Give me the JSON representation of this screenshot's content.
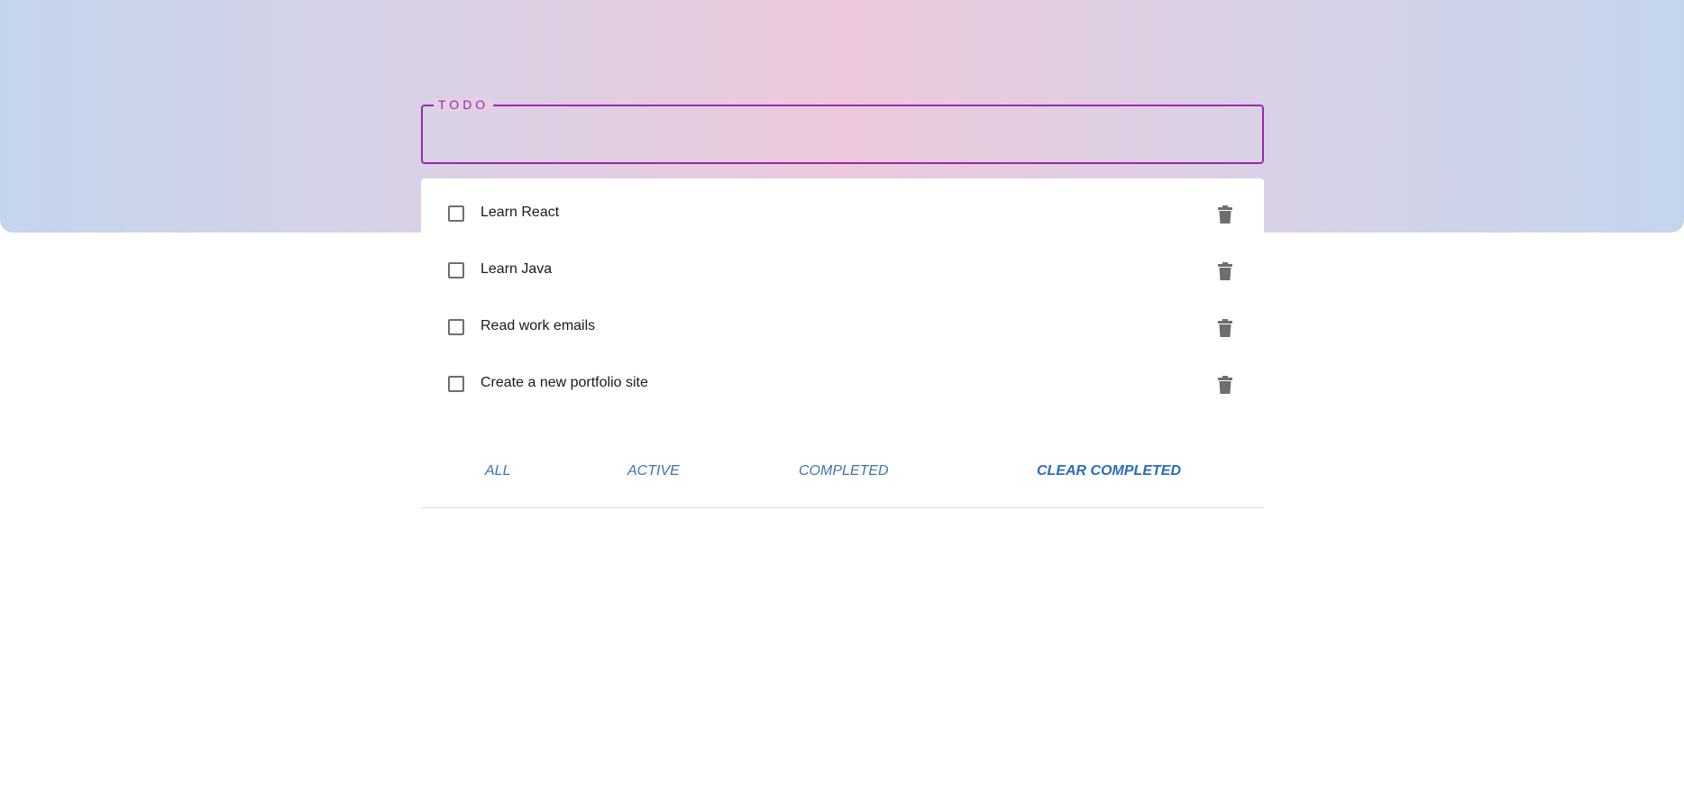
{
  "input": {
    "label": "TODO",
    "value": ""
  },
  "todos": [
    {
      "text": "Learn React",
      "completed": false
    },
    {
      "text": "Learn Java",
      "completed": false
    },
    {
      "text": "Read work emails",
      "completed": false
    },
    {
      "text": "Create a new portfolio site",
      "completed": false
    }
  ],
  "filters": {
    "all": "ALL",
    "active": "ACTIVE",
    "completed": "COMPLETED",
    "clear": "CLEAR COMPLETED"
  },
  "colors": {
    "accent": "#9c27b0",
    "link": "#3d74b0",
    "icon": "#6e6e6e"
  },
  "icons": {
    "delete": "trash-icon",
    "checkbox": "checkbox-unchecked-icon"
  }
}
